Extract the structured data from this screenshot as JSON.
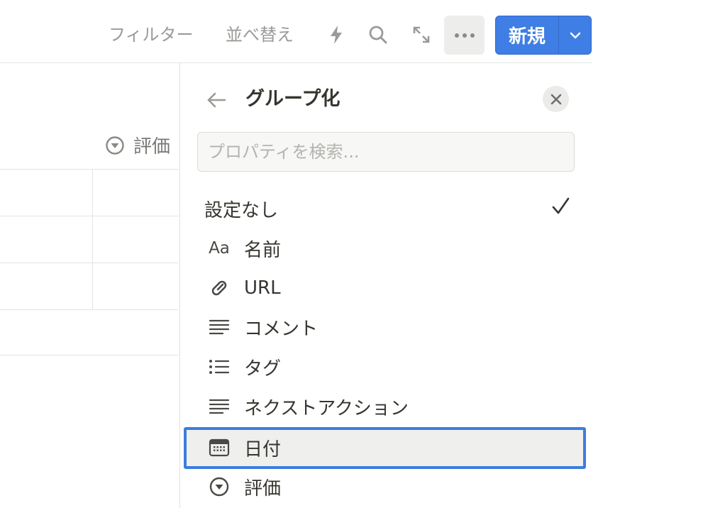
{
  "toolbar": {
    "filter_label": "フィルター",
    "sort_label": "並べ替え",
    "new_label": "新規",
    "icons": [
      "lightning-icon",
      "search-icon",
      "expand-icon",
      "more-icon",
      "chevron-down-icon"
    ]
  },
  "table": {
    "column_header": "評価"
  },
  "panel": {
    "title": "グループ化",
    "search_placeholder": "プロパティを検索...",
    "items": [
      {
        "label": "設定なし",
        "icon": "",
        "checked": true
      },
      {
        "label": "名前",
        "icon": "Aa"
      },
      {
        "label": "URL",
        "icon": "link-icon"
      },
      {
        "label": "コメント",
        "icon": "text-icon"
      },
      {
        "label": "タグ",
        "icon": "list-icon"
      },
      {
        "label": "ネクストアクション",
        "icon": "text-icon"
      },
      {
        "label": "日付",
        "icon": "calendar-icon",
        "highlighted": true
      },
      {
        "label": "評価",
        "icon": "select-icon"
      }
    ]
  },
  "colors": {
    "accent": "#3f7ee4",
    "highlight_border": "#3b7ddd",
    "muted_text": "#9b9a97",
    "text": "#37352f"
  }
}
